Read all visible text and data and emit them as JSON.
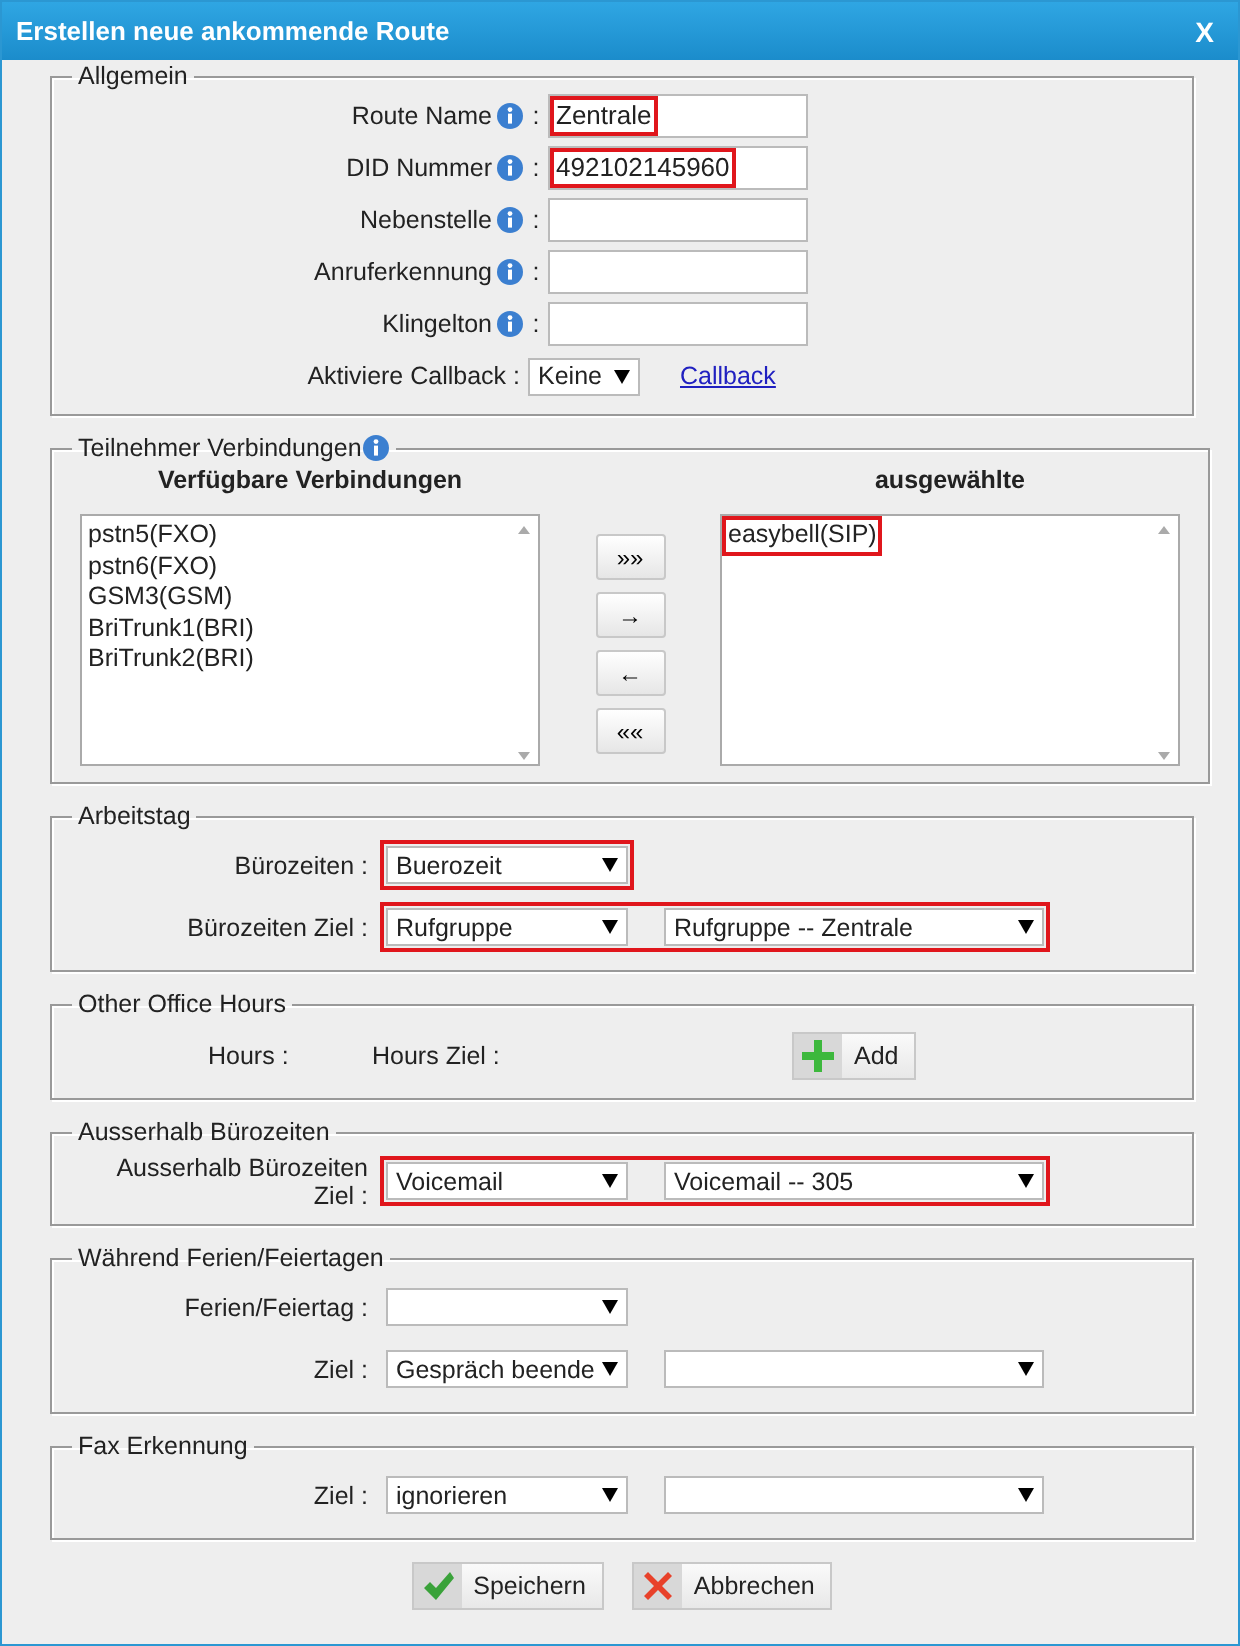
{
  "window": {
    "title": "Erstellen neue ankommende Route",
    "close": "X"
  },
  "general": {
    "legend": "Allgemein",
    "fields": [
      {
        "label": "Route Name",
        "colon": ":",
        "value": "Zentrale",
        "highlighted": true
      },
      {
        "label": "DID Nummer",
        "colon": ":",
        "value": "492102145960",
        "highlighted": true
      },
      {
        "label": "Nebenstelle",
        "colon": ":"
      },
      {
        "label": "Anruferkennung",
        "colon": ":"
      },
      {
        "label": "Klingelton",
        "colon": ":"
      }
    ],
    "callback": {
      "label": "Aktiviere Callback :",
      "value": "Keine",
      "link": "Callback"
    }
  },
  "members": {
    "legend": "Teilnehmer Verbindungen",
    "available": {
      "heading": "Verfügbare Verbindungen",
      "items": [
        {
          "label": "pstn5(FXO)",
          "highlighted": false
        },
        {
          "label": "pstn6(FXO)",
          "highlighted": false
        },
        {
          "label": "GSM3(GSM)",
          "highlighted": false
        },
        {
          "label": "BriTrunk1(BRI)",
          "highlighted": false
        },
        {
          "label": "BriTrunk2(BRI)",
          "highlighted": false
        }
      ]
    },
    "selected": {
      "heading": "ausgewählte",
      "items": [
        {
          "label": "easybell(SIP)",
          "highlighted": true
        }
      ]
    },
    "move_buttons": [
      "»»",
      "→",
      "←",
      "««"
    ]
  },
  "sections": [
    {
      "kind": "selects",
      "legend": "Arbeitstag",
      "rows": [
        {
          "label": "Bürozeiten :",
          "highlighted": true,
          "selects": [
            {
              "kind": "narrow",
              "value": "Buerozeit"
            }
          ]
        },
        {
          "label": "Bürozeiten Ziel :",
          "highlighted": true,
          "selects": [
            {
              "kind": "narrow",
              "value": "Rufgruppe"
            },
            {
              "kind": "wide",
              "value": "Rufgruppe -- Zentrale"
            }
          ]
        }
      ]
    },
    {
      "kind": "hours",
      "legend": "Other Office Hours",
      "hours_label": "Hours :",
      "target_label": "Hours Ziel :",
      "add_button": "Add"
    },
    {
      "kind": "selects",
      "legend": "Ausserhalb Bürozeiten",
      "rows": [
        {
          "label": "Ausserhalb Bürozeiten Ziel :",
          "highlighted": true,
          "selects": [
            {
              "kind": "narrow",
              "value": "Voicemail"
            },
            {
              "kind": "wide",
              "value": "Voicemail -- 305"
            }
          ]
        }
      ]
    },
    {
      "kind": "selects",
      "legend": "Während Ferien/Feiertagen",
      "rows": [
        {
          "label": "Ferien/Feiertag :",
          "highlighted": false,
          "selects": [
            {
              "kind": "narrow"
            }
          ]
        },
        {
          "label": "Ziel :",
          "highlighted": false,
          "selects": [
            {
              "kind": "narrow",
              "value": "Gespräch beende"
            },
            {
              "kind": "wide"
            }
          ]
        }
      ]
    },
    {
      "kind": "selects",
      "legend": "Fax Erkennung",
      "rows": [
        {
          "label": "Ziel :",
          "highlighted": false,
          "selects": [
            {
              "kind": "narrow",
              "value": "ignorieren"
            },
            {
              "kind": "wide"
            }
          ]
        }
      ]
    }
  ],
  "buttons": [
    {
      "kind": "save",
      "label": "Speichern"
    },
    {
      "kind": "cancel",
      "label": "Abbrechen"
    }
  ]
}
